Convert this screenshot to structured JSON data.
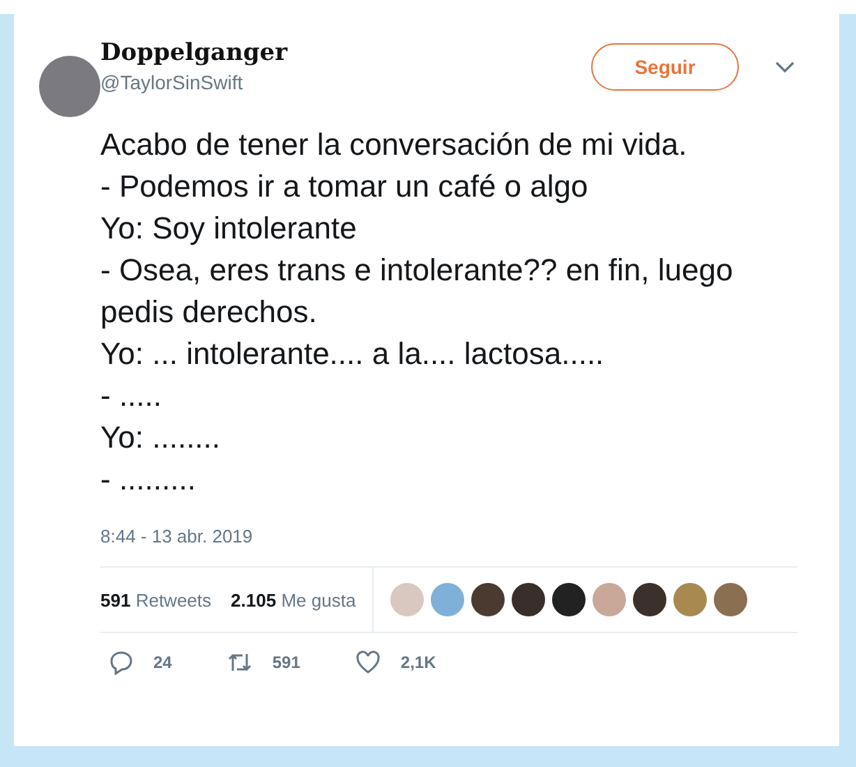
{
  "author": {
    "name": "Doppelganger",
    "handle": "@TaylorSinSwift"
  },
  "follow_button": "Seguir",
  "tweet_lines": [
    "Acabo de tener la conversación de mi vida.",
    "- Podemos ir a tomar un café o algo",
    "Yo: Soy intolerante",
    "- Osea, eres trans e intolerante?? en fin, luego pedis derechos.",
    "Yo: ... intolerante.... a la.... lactosa.....",
    "- .....",
    "Yo: ........",
    "- ........."
  ],
  "timestamp": "8:44 - 13 abr. 2019",
  "stats": [
    {
      "count": "591",
      "label": "Retweets"
    },
    {
      "count": "2.105",
      "label": "Me gusta"
    }
  ],
  "actions": [
    {
      "kind": "reply",
      "count": "24"
    },
    {
      "kind": "retweet",
      "count": "591"
    },
    {
      "kind": "like",
      "count": "2,1K"
    }
  ]
}
